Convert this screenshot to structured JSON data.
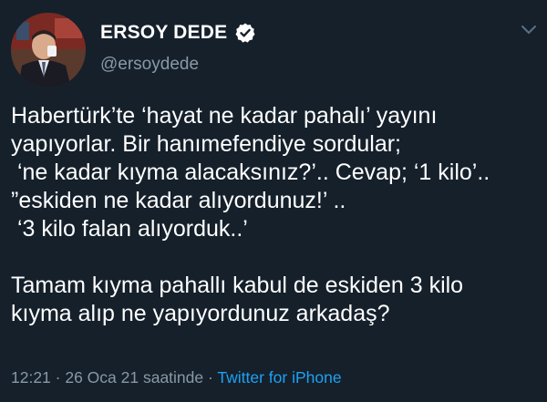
{
  "author": {
    "display_name": "ERSOY DEDE",
    "handle": "@ersoydede",
    "verified": true,
    "avatar_icon": "profile-photo"
  },
  "tweet": {
    "lines": [
      "Habertürk’te ‘hayat ne kadar pahalı’ yayını",
      "yapıyorlar. Bir hanımefendiye sordular;",
      " ‘ne kadar kıyma alacaksınız?’.. Cevap; ‘1 kilo’..",
      "”eskiden ne kadar alıyordunuz!’ ..",
      " ‘3 kilo falan alıyorduk..’",
      "",
      "Tamam kıyma pahallı kabul de eskiden 3 kilo",
      "kıyma alıp ne yapıyordunuz arkadaş?"
    ]
  },
  "meta": {
    "time": "12:21",
    "sep1": " · ",
    "date": "26 Oca 21 saatinde",
    "sep2": " · ",
    "source": "Twitter for iPhone"
  },
  "colors": {
    "background": "#15202b",
    "secondary_text": "#8899a6",
    "link": "#1da1f2"
  }
}
